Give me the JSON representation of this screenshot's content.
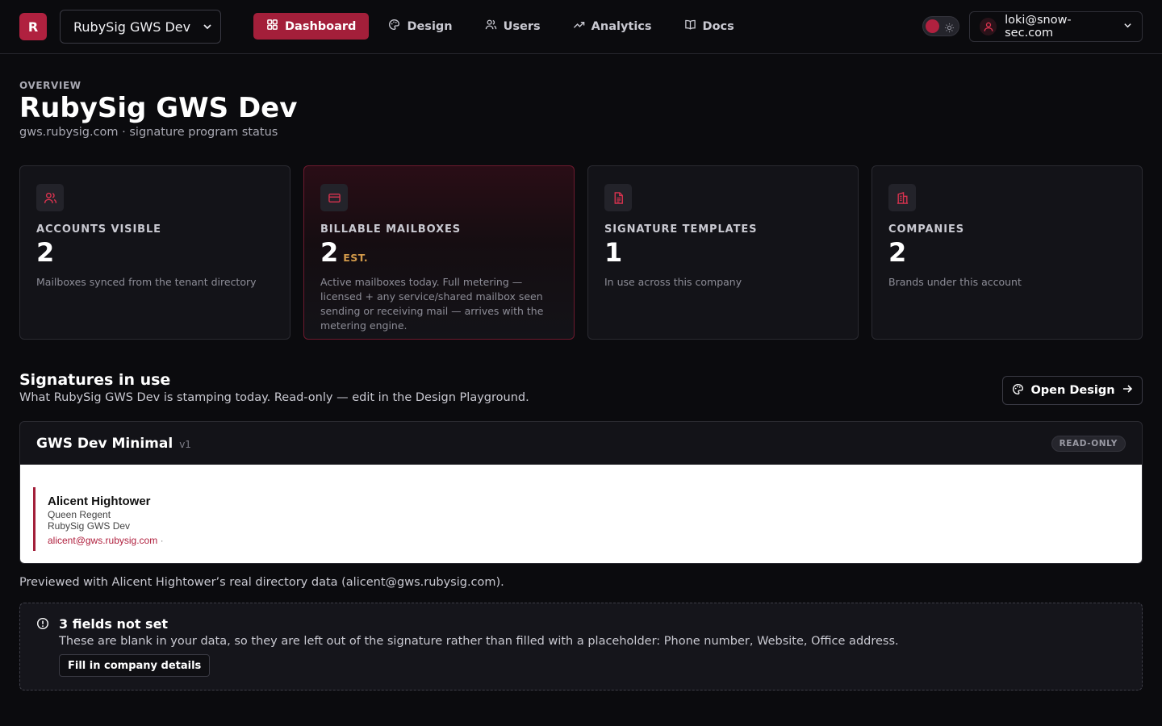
{
  "brand": {
    "logo_letter": "R",
    "accent": "#a31f3a"
  },
  "header": {
    "workspace_select": "RubySig GWS Dev",
    "nav": [
      {
        "label": "Dashboard",
        "icon": "dashboard-icon",
        "active": true
      },
      {
        "label": "Design",
        "icon": "palette-icon",
        "active": false
      },
      {
        "label": "Users",
        "icon": "users-icon",
        "active": false
      },
      {
        "label": "Analytics",
        "icon": "trend-icon",
        "active": false
      },
      {
        "label": "Docs",
        "icon": "book-icon",
        "active": false
      }
    ],
    "theme_toggle": "dark",
    "user_email": "loki@snow-sec.com"
  },
  "page": {
    "eyebrow": "OVERVIEW",
    "title": "RubySig GWS Dev",
    "subtitle": "gws.rubysig.com · signature program status"
  },
  "stats": [
    {
      "label": "ACCOUNTS VISIBLE",
      "value": "2",
      "suffix": "",
      "description": "Mailboxes synced from the tenant directory",
      "icon": "users-icon"
    },
    {
      "label": "BILLABLE MAILBOXES",
      "value": "2",
      "suffix": "EST.",
      "description": "Active mailboxes today. Full metering — licensed + any service/shared mailbox seen sending or receiving mail — arrives with the metering engine.",
      "icon": "credit-card-icon"
    },
    {
      "label": "SIGNATURE TEMPLATES",
      "value": "1",
      "suffix": "",
      "description": "In use across this company",
      "icon": "document-icon"
    },
    {
      "label": "COMPANIES",
      "value": "2",
      "suffix": "",
      "description": "Brands under this account",
      "icon": "building-icon"
    }
  ],
  "signatures": {
    "title": "Signatures in use",
    "subtitle": "What RubySig GWS Dev is stamping today. Read-only — edit in the Design Playground.",
    "open_button": "Open Design",
    "template_name": "GWS Dev Minimal",
    "template_version": "v1",
    "badge": "READ-ONLY",
    "preview": {
      "name": "Alicent Hightower",
      "role": "Queen Regent",
      "company": "RubySig GWS Dev",
      "email": "alicent@gws.rubysig.com",
      "separator": "·"
    },
    "preview_note": "Previewed with Alicent Hightower’s real directory data (alicent@gws.rubysig.com)."
  },
  "alert": {
    "title": "3 fields not set",
    "text": "These are blank in your data, so they are left out of the signature rather than filled with a placeholder: Phone number, Website, Office address.",
    "button": "Fill in company details"
  }
}
